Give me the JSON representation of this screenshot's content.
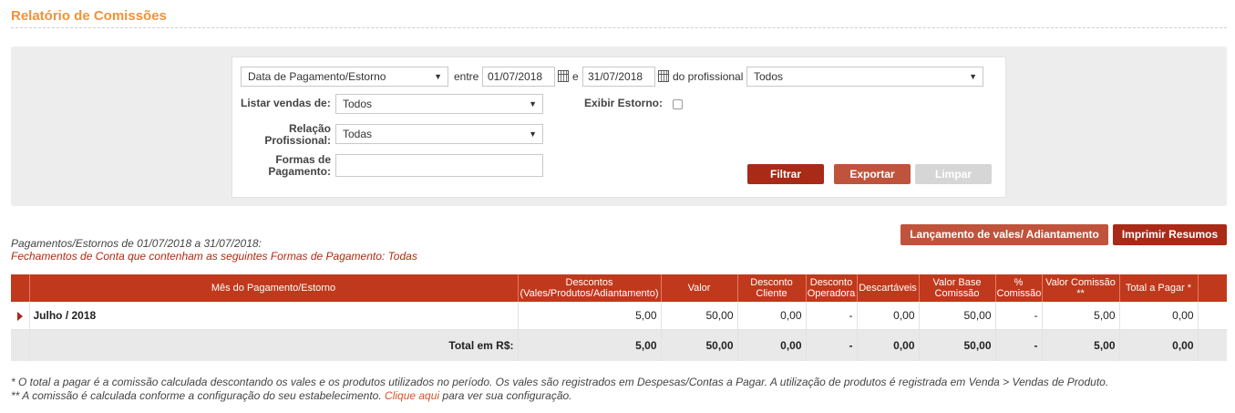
{
  "page": {
    "title": "Relatório de Comissões"
  },
  "filters": {
    "date_type": "Data de Pagamento/Estorno",
    "between_label": "entre",
    "date_from": "01/07/2018",
    "and_label": "e",
    "date_to": "31/07/2018",
    "professional_label": "do profissional",
    "professional_value": "Todos",
    "list_sales_label": "Listar vendas de:",
    "list_sales_value": "Todos",
    "show_reversal_label": "Exibir Estorno:",
    "relation_label_1": "Relação",
    "relation_label_2": "Profissional:",
    "relation_value": "Todas",
    "payment_label_1": "Formas de",
    "payment_label_2": "Pagamento:",
    "payment_value": ""
  },
  "buttons": {
    "filter": "Filtrar",
    "export": "Exportar",
    "clear": "Limpar",
    "vouchers": "Lançamento de vales/ Adiantamento",
    "print": "Imprimir Resumos"
  },
  "summary": {
    "period": "Pagamentos/Estornos de 01/07/2018 a 31/07/2018:",
    "closings": "Fechamentos de Conta que contenham as seguintes Formas de Pagamento: Todas"
  },
  "table": {
    "headers": {
      "month": "Mês do Pagamento/Estorno",
      "discounts_1": "Descontos",
      "discounts_2": "(Vales/Produtos/Adiantamento)",
      "value": "Valor",
      "client_discount_1": "Desconto",
      "client_discount_2": "Cliente",
      "operator_discount_1": "Desconto",
      "operator_discount_2": "Operadora",
      "disposables": "Descartáveis",
      "base_value_1": "Valor Base",
      "base_value_2": "Comissão",
      "pct_1": "%",
      "pct_2": "Comissão",
      "commission_1": "Valor Comissão",
      "commission_2": "**",
      "to_pay": "Total a Pagar *"
    },
    "row": {
      "month": "Julho / 2018",
      "discounts": "5,00",
      "value": "50,00",
      "client_discount": "0,00",
      "operator_discount": "-",
      "disposables": "0,00",
      "base_value": "50,00",
      "pct": "-",
      "commission": "5,00",
      "to_pay": "0,00"
    },
    "total": {
      "label": "Total em R$:",
      "discounts": "5,00",
      "value": "50,00",
      "client_discount": "0,00",
      "operator_discount": "-",
      "disposables": "0,00",
      "base_value": "50,00",
      "pct": "-",
      "commission": "5,00",
      "to_pay": "0,00"
    }
  },
  "footnotes": {
    "note1": "* O total a pagar é a comissão calculada descontando os vales e os produtos utilizados no período. Os vales são registrados em Despesas/Contas a Pagar. A utilização de produtos é registrada em Venda > Vendas de Produto.",
    "note2_prefix": "** A comissão é calculada conforme a configuração do seu estabelecimento.",
    "note2_link": "Clique aqui",
    "note2_suffix": "para ver sua configuração."
  },
  "colors": {
    "title": "#f0923c",
    "header_bg": "#c0391c",
    "btn_dark": "#a82a17",
    "btn_mid": "#c0533c",
    "link": "#d2562b"
  },
  "icons": [
    "calendar-icon",
    "dropdown-arrow-icon",
    "expand-row-icon",
    "checkbox"
  ]
}
